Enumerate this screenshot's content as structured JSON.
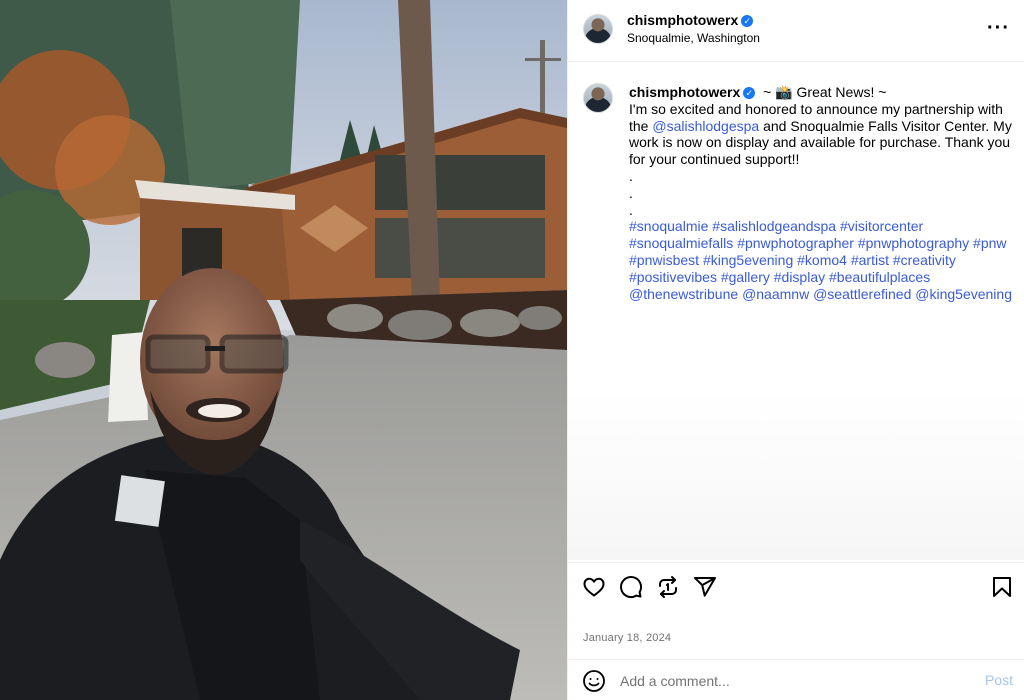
{
  "post": {
    "username": "chismphotowerx",
    "verified": true,
    "location": "Snoqualmie, Washington",
    "date": "January 18, 2024"
  },
  "caption": {
    "headline": "~ 📸 Great News! ~",
    "line1": "I'm so excited and honored to announce my partnership with the",
    "mention1": "@salishlodgespa",
    "line2": " and Snoqualmie Falls Visitor Center. My work is now on display and available for purchase. Thank you for your continued support!!",
    "dots": [
      ".",
      ".",
      "."
    ],
    "hashtags": [
      "#snoqualmie",
      "#salishlodgeandspa",
      "#visitorcenter",
      "#snoqualmiefalls",
      "#pnwphotographer",
      "#pnwphotography",
      "#pnw",
      "#pnwisbest",
      "#king5evening",
      "#komo4",
      "#artist",
      "#creativity",
      "#positivevibes",
      "#gallery",
      "#display",
      "#beautifulplaces",
      "@thenewstribune",
      "@naamnw",
      "@seattlerefined",
      "@king5evening"
    ]
  },
  "icons": {
    "more": "more-options-icon",
    "like": "heart-icon",
    "comment": "comment-icon",
    "repost": "repost-icon",
    "share": "send-icon",
    "save": "bookmark-icon",
    "emoji": "emoji-icon",
    "verified": "verified-badge-icon"
  },
  "comment_box": {
    "placeholder": "Add a comment...",
    "post_label": "Post"
  },
  "colors": {
    "link": "#3a5bd9",
    "verified": "#1877f2",
    "post_button_disabled": "#a5c3f2",
    "muted": "#737373"
  }
}
